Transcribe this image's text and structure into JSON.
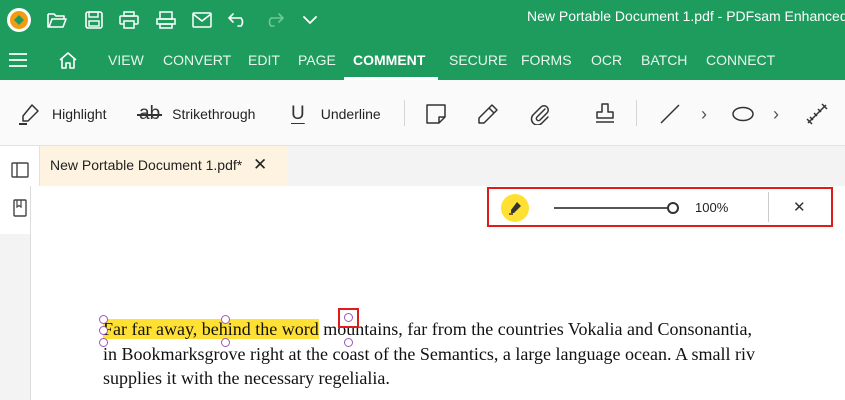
{
  "app": {
    "window_title": "New Portable Document 1.pdf   -   PDFsam Enhanced"
  },
  "quick_access": {
    "icons": [
      "logo-icon",
      "open-icon",
      "save-icon",
      "print-icon",
      "scan-icon",
      "mail-icon",
      "undo-icon",
      "redo-icon",
      "more-icon"
    ]
  },
  "menu": {
    "items": [
      {
        "label": "VIEW"
      },
      {
        "label": "CONVERT"
      },
      {
        "label": "EDIT"
      },
      {
        "label": "PAGE"
      },
      {
        "label": "COMMENT"
      },
      {
        "label": "SECURE"
      },
      {
        "label": "FORMS"
      },
      {
        "label": "OCR"
      },
      {
        "label": "BATCH"
      },
      {
        "label": "CONNECT"
      }
    ],
    "active": "COMMENT"
  },
  "toolbar": {
    "highlight_label": "Highlight",
    "strikethrough_label": "Strikethrough",
    "strikethrough_glyph": "ab",
    "underline_label": "Underline",
    "underline_glyph": "U",
    "more_glyph": "›"
  },
  "tabs": {
    "document_tab_label": "New Portable Document 1.pdf*",
    "close_glyph": "✕"
  },
  "highlight_bar": {
    "opacity_value": "100%",
    "opacity_fraction": 1.0,
    "close_glyph": "✕",
    "color": "#ffe033"
  },
  "document": {
    "line1_highlighted": "Far far away, behind the word",
    "line1_rest": " mountains, far from the countries Vokalia and Consonantia,",
    "line2": "in Bookmarksgrove right at the coast of the Semantics, a large language ocean. A small riv",
    "line3": "supplies it with the necessary regelialia."
  },
  "colors": {
    "brand_green": "#1e9c5e",
    "highlight_yellow": "#ffe033",
    "selection_red": "#e01b1b"
  }
}
